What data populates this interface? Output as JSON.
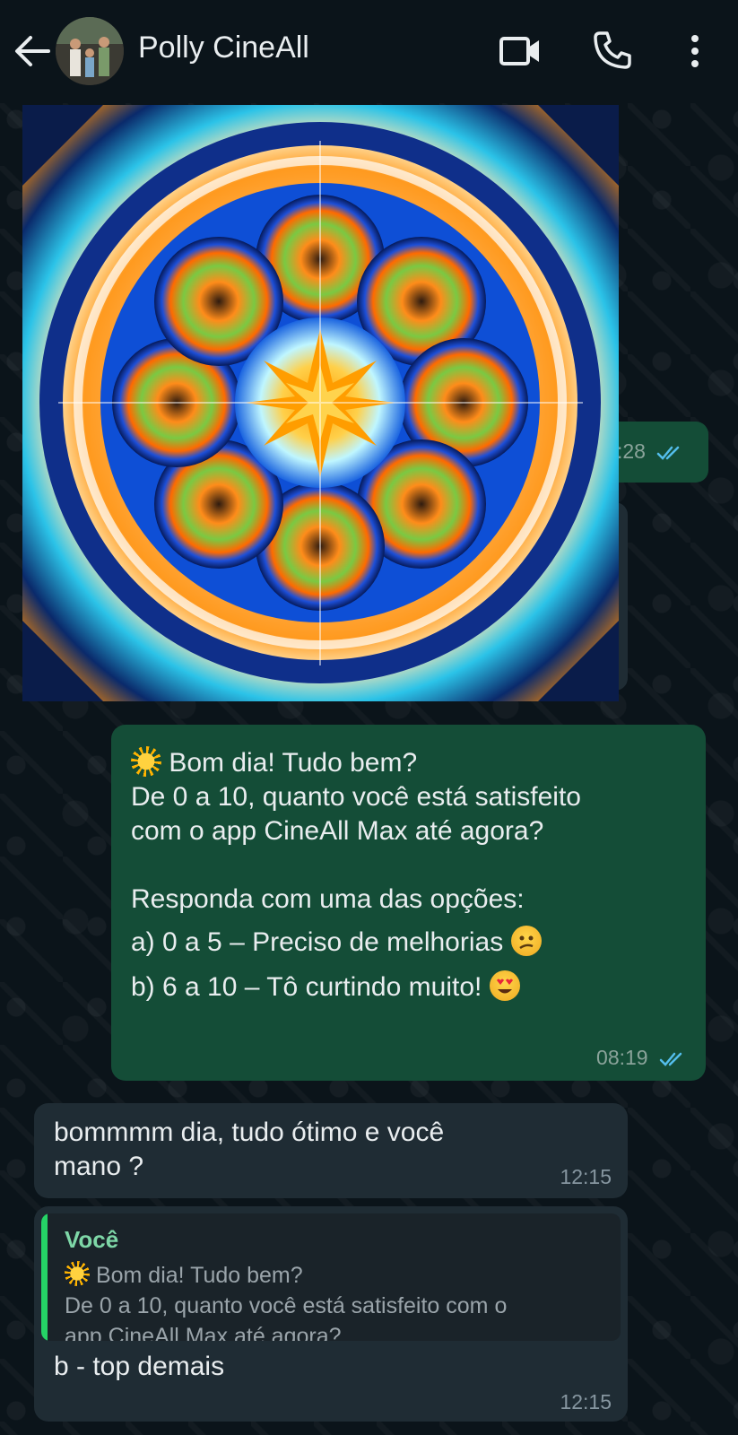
{
  "header": {
    "contact_name": "Polly CineAll",
    "icons": [
      "back-arrow-icon",
      "avatar",
      "video-call-icon",
      "voice-call-icon",
      "more-vert-icon"
    ]
  },
  "messages": [
    {
      "type": "image",
      "direction": "outgoing",
      "time_partial": ":28"
    },
    {
      "type": "text",
      "direction": "outgoing",
      "lines": [
        "Bom dia! Tudo bem?",
        "De 0 a 10, quanto você está satisfeito",
        "com o app CineAll Max até agora?",
        "Responda com uma das opções:",
        "a) 0 a 5 – Preciso de melhorias",
        "b) 6 a 10 – Tô curtindo muito!"
      ],
      "time": "08:19"
    },
    {
      "type": "text",
      "direction": "incoming",
      "lines": [
        "bommmm dia, tudo ótimo e você",
        "mano ?"
      ],
      "time": "12:15"
    },
    {
      "type": "reply",
      "direction": "incoming",
      "quote_author": "Você",
      "quote_lines": [
        "Bom dia! Tudo bem?",
        "De 0 a 10, quanto você está satisfeito com o",
        "app CineAll Max até agora?..."
      ],
      "text": "b - top demais",
      "time": "12:15"
    }
  ],
  "colors": {
    "background": "#0b141a",
    "outgoing_bubble": "#144d37",
    "incoming_bubble": "#1f2c34",
    "read_ticks": "#53bdeb",
    "quote_accent": "#25d366"
  }
}
